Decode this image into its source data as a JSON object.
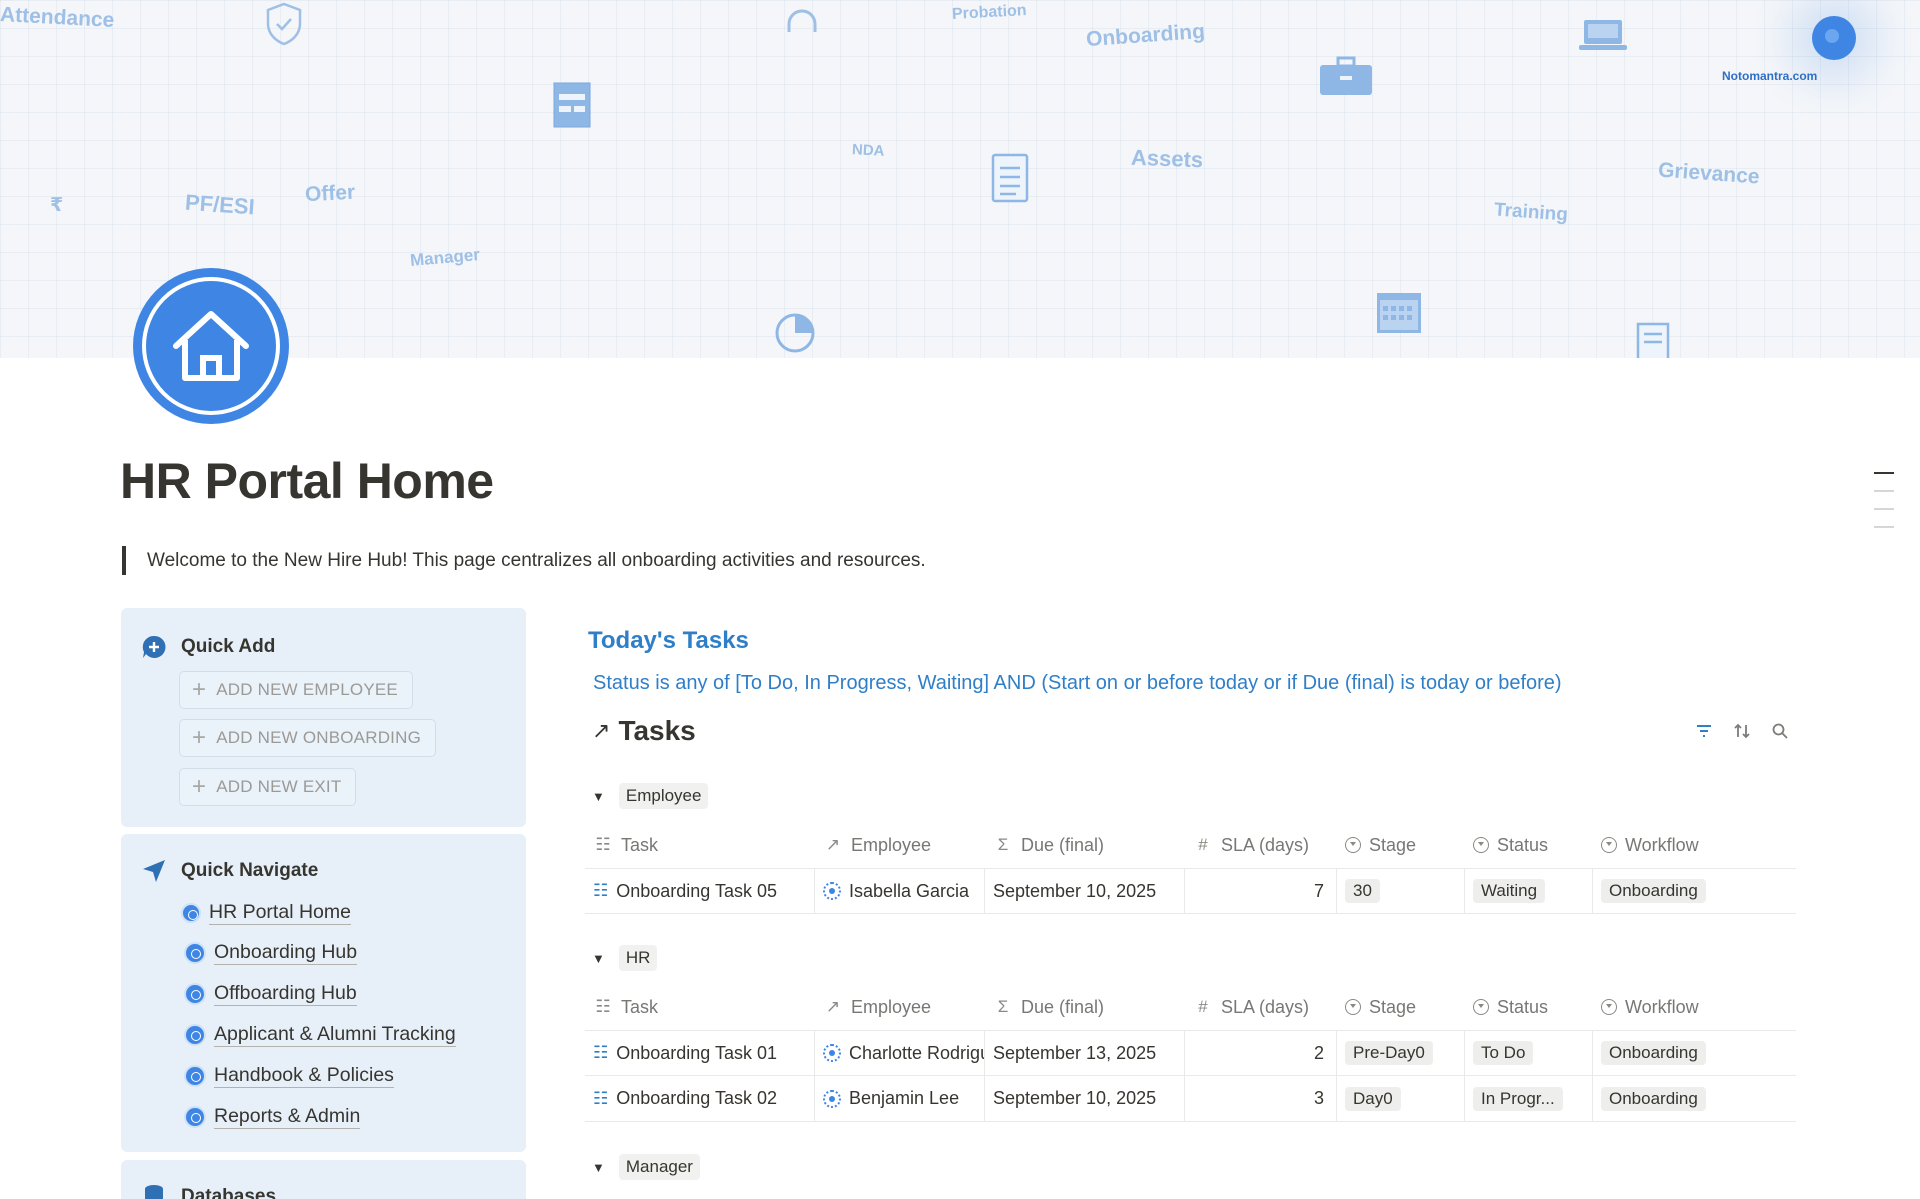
{
  "cover": {
    "words": [
      "Attendance",
      "Probation",
      "Onboarding",
      "NDA",
      "Assets",
      "Grievance",
      "PF/ESI",
      "Offer",
      "Training",
      "Manager",
      "₹"
    ],
    "brand": "Notomantra.com"
  },
  "page": {
    "title": "HR Portal Home",
    "callout": "Welcome to the New Hire Hub! This page centralizes all onboarding activities and resources."
  },
  "quick_add": {
    "heading": "Quick Add",
    "buttons": [
      "ADD NEW EMPLOYEE",
      "ADD NEW ONBOARDING",
      "ADD NEW EXIT"
    ]
  },
  "quick_navigate": {
    "heading": "Quick Navigate",
    "items": [
      "HR Portal Home",
      "Onboarding Hub",
      "Offboarding Hub",
      "Applicant & Alumni Tracking",
      "Handbook & Policies",
      "Reports & Admin"
    ]
  },
  "databases": {
    "heading": "Databases"
  },
  "tasks_view": {
    "heading": "Today's Tasks",
    "filter": "Status is any of [To Do, In Progress, Waiting] AND (Start on or before today or if Due (final) is today or before)",
    "db_title": "Tasks",
    "columns": [
      "Task",
      "Employee",
      "Due (final)",
      "SLA (days)",
      "Stage",
      "Status",
      "Workflow"
    ],
    "groups": [
      {
        "name": "Employee",
        "rows": [
          {
            "task": "Onboarding Task 05",
            "employee": "Isabella Garcia",
            "due": "September 10, 2025",
            "sla": "7",
            "stage": "30",
            "status": "Waiting",
            "workflow": "Onboarding"
          }
        ]
      },
      {
        "name": "HR",
        "rows": [
          {
            "task": "Onboarding Task 01",
            "employee": "Charlotte Rodriguez",
            "due": "September 13, 2025",
            "sla": "2",
            "stage": "Pre-Day0",
            "status": "To Do",
            "workflow": "Onboarding"
          },
          {
            "task": "Onboarding Task 02",
            "employee": "Benjamin Lee",
            "due": "September 10, 2025",
            "sla": "3",
            "stage": "Day0",
            "status": "In Progr...",
            "workflow": "Onboarding"
          }
        ]
      },
      {
        "name": "Manager",
        "rows": []
      }
    ]
  },
  "colors": {
    "accent": "#3f86e4",
    "link_blue": "#2f7fc8",
    "panel_bg": "#e7f0f9"
  }
}
